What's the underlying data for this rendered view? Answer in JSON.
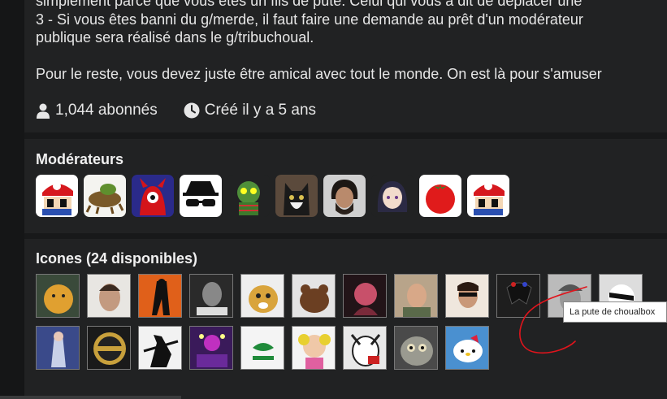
{
  "info": {
    "rules_line_cut": "simplement parce que vous êtes un fils de pute. Celui qui vous a dit de déplacer une",
    "rule3_line1": "3 - Si vous êtes banni du g/merde, il faut faire une demande au prêt d'un modérateur",
    "rule3_line2": "publique sera réalisé dans le g/tribuchoual.",
    "closing": "Pour le reste, vous devez juste être amical avec tout le monde. On est là pour s'amuser"
  },
  "stats": {
    "subscribers": "1,044 abonnés",
    "created": "Créé il y a 5 ans",
    "subscribers_icon": "user-icon",
    "created_icon": "clock-icon"
  },
  "moderators": {
    "title": "Modérateurs",
    "avatars": [
      "mario-cap-avatar",
      "frog-avatar",
      "red-devil-avatar",
      "spy-glasses-avatar",
      "green-creature-avatar",
      "cat-avatar",
      "bearded-man-avatar",
      "anime-girl-avatar",
      "tomato-avatar",
      "mario-cap-avatar"
    ]
  },
  "icons": {
    "title": "Icones (24 disponibles)",
    "tooltip": "La pute de choualbox"
  },
  "colors": {
    "page_bg": "#18191a",
    "panel_bg": "#212223",
    "annotation": "#e0141c"
  }
}
